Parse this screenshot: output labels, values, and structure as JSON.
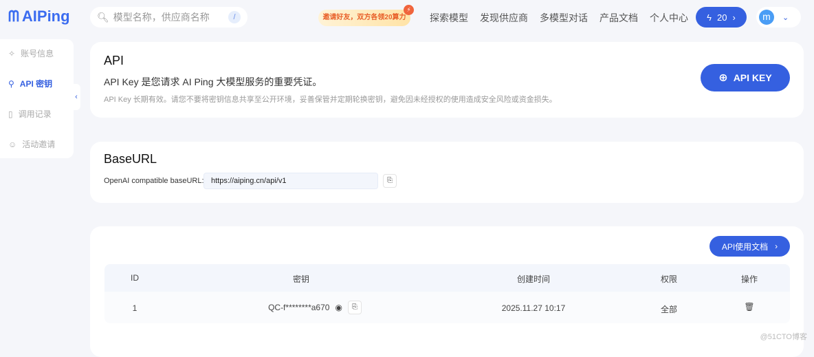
{
  "header": {
    "logo": "AIPing",
    "search_placeholder": "模型名称，供应商名称",
    "search_shortcut": "/",
    "invite": "邀请好友，双方各领20算力",
    "nav": [
      "探索模型",
      "发现供应商",
      "多模型对话",
      "产品文档",
      "个人中心"
    ],
    "balance": "20",
    "avatar_letter": "m"
  },
  "sidebar": {
    "items": [
      {
        "label": "账号信息",
        "icon": "sparkle-icon"
      },
      {
        "label": "API 密钥",
        "icon": "key-icon",
        "active": true
      },
      {
        "label": "调用记录",
        "icon": "document-icon"
      },
      {
        "label": "活动邀请",
        "icon": "users-icon"
      }
    ]
  },
  "api": {
    "title": "API",
    "subtitle": "API Key 是您请求 AI Ping 大模型服务的重要凭证。",
    "note": "API Key 长期有效。请您不要将密钥信息共享至公开环境，妥善保管并定期轮换密钥，避免因未经授权的使用造成安全风险或资金损失。",
    "button": "API KEY"
  },
  "baseurl": {
    "title": "BaseURL",
    "label": "OpenAI compatible baseURL:",
    "value": "https://aiping.cn/api/v1"
  },
  "keys": {
    "doc_button": "API使用文档",
    "columns": [
      "ID",
      "密钥",
      "创建时间",
      "权限",
      "操作"
    ],
    "rows": [
      {
        "id": "1",
        "key": "QC-f********a670",
        "created": "2025.11.27 10:17",
        "perm": "全部"
      }
    ]
  },
  "watermark": "@51CTO博客",
  "colors": {
    "accent": "#3560e0",
    "background": "#f5f6fa"
  }
}
